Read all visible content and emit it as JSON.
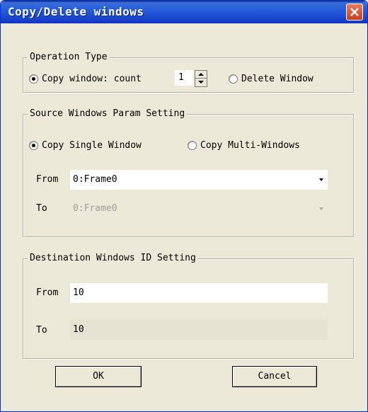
{
  "window": {
    "title": "Copy/Delete windows"
  },
  "operation": {
    "legend": "Operation Type",
    "copy_label": "Copy window: count",
    "count_value": "1",
    "delete_label": "Delete Window",
    "selected": "copy"
  },
  "source": {
    "legend": "Source Windows Param Setting",
    "single_label": "Copy Single Window",
    "multi_label": "Copy Multi-Windows",
    "selected": "single",
    "from_label": "From",
    "from_value": "0:Frame0",
    "to_label": "To",
    "to_value": "0:Frame0"
  },
  "destination": {
    "legend": "Destination Windows ID Setting",
    "from_label": "From",
    "from_value": "10",
    "to_label": "To",
    "to_value": "10"
  },
  "buttons": {
    "ok": "OK",
    "cancel": "Cancel"
  },
  "icons": {
    "close": "close-icon",
    "spin_up": "chevron-up-icon",
    "spin_down": "chevron-down-icon",
    "dropdown": "chevron-down-icon"
  }
}
